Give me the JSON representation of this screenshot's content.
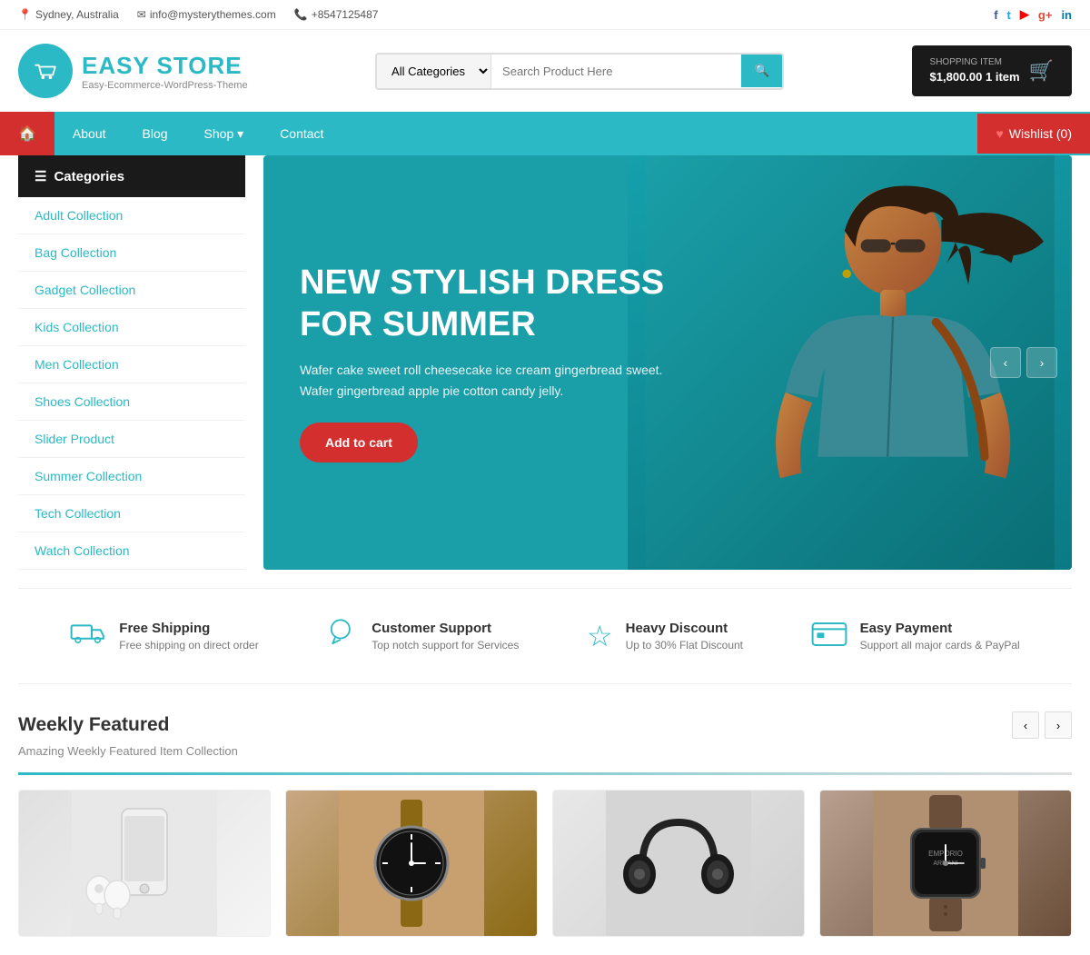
{
  "topbar": {
    "location": "Sydney, Australia",
    "email": "info@mysterythemes.com",
    "phone": "+8547125487",
    "social": [
      {
        "name": "facebook",
        "symbol": "f",
        "color": "#3b5998"
      },
      {
        "name": "twitter",
        "symbol": "t",
        "color": "#1da1f2"
      },
      {
        "name": "youtube",
        "symbol": "▶",
        "color": "#ff0000"
      },
      {
        "name": "google",
        "symbol": "g+",
        "color": "#dd4b39"
      },
      {
        "name": "linkedin",
        "symbol": "in",
        "color": "#0077b5"
      }
    ]
  },
  "header": {
    "logo_name": "EASY STORE",
    "logo_tagline": "Easy-Ecommerce-WordPress-Theme",
    "search_placeholder": "Search Product Here",
    "search_category_default": "All Categories",
    "cart_label": "SHOPPING ITEM",
    "cart_amount": "$1,800.00",
    "cart_items": "1 item"
  },
  "nav": {
    "home_label": "🏠",
    "items": [
      {
        "label": "About",
        "href": "#"
      },
      {
        "label": "Blog",
        "href": "#"
      },
      {
        "label": "Shop",
        "href": "#",
        "has_dropdown": true
      },
      {
        "label": "Contact",
        "href": "#"
      }
    ],
    "wishlist_label": "Wishlist (0)"
  },
  "sidebar": {
    "header_label": "Categories",
    "items": [
      {
        "label": "Adult Collection"
      },
      {
        "label": "Bag Collection"
      },
      {
        "label": "Gadget Collection"
      },
      {
        "label": "Kids Collection"
      },
      {
        "label": "Men Collection"
      },
      {
        "label": "Shoes Collection"
      },
      {
        "label": "Slider Product"
      },
      {
        "label": "Summer Collection"
      },
      {
        "label": "Tech Collection"
      },
      {
        "label": "Watch Collection"
      }
    ]
  },
  "hero": {
    "title_line1": "NEW STYLISH DRESS",
    "title_line2": "FOR SUMMER",
    "description": "Wafer cake sweet roll cheesecake ice cream gingerbread sweet. Wafer gingerbread apple pie cotton candy jelly.",
    "button_label": "Add to cart"
  },
  "features": [
    {
      "icon": "truck",
      "title": "Free Shipping",
      "description": "Free shipping on direct order"
    },
    {
      "icon": "chat",
      "title": "Customer Support",
      "description": "Top notch support for Services"
    },
    {
      "icon": "star",
      "title": "Heavy Discount",
      "description": "Up to 30% Flat Discount"
    },
    {
      "icon": "card",
      "title": "Easy Payment",
      "description": "Support all major cards & PayPal"
    }
  ],
  "weekly": {
    "title": "Weekly Featured",
    "subtitle": "Amazing Weekly Featured Item Collection",
    "products": [
      {
        "type": "phone",
        "bg": "#e8e8e8"
      },
      {
        "type": "watch",
        "bg": "#c8a070"
      },
      {
        "type": "headphones",
        "bg": "#d8d8d8"
      },
      {
        "type": "watch2",
        "bg": "#b0906a"
      }
    ]
  }
}
